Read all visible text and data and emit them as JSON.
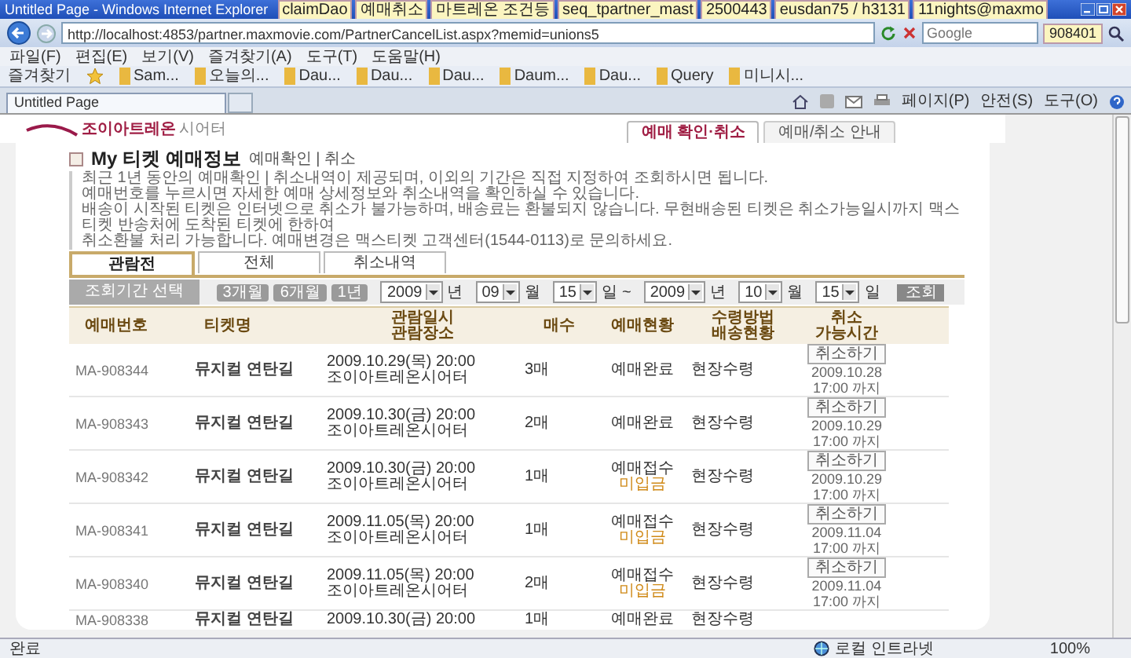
{
  "window": {
    "title": "Untitled Page - Windows Internet Explorer"
  },
  "overlay_notes": [
    "claimDao",
    "예매취소",
    "마트레온 조건등",
    "seq_tpartner_mast",
    "2500443",
    "eusdan75 / h3131",
    "11nights@maxmo"
  ],
  "address_bar": {
    "url": "http://localhost:4853/partner.maxmovie.com/PartnerCancelList.aspx?memid=unions5"
  },
  "search": {
    "placeholder": "Google",
    "note": "908401"
  },
  "menu": [
    "파일(F)",
    "편집(E)",
    "보기(V)",
    "즐겨찾기(A)",
    "도구(T)",
    "도움말(H)"
  ],
  "favorites": {
    "label": "즐겨찾기",
    "items": [
      "Sam...",
      "오늘의...",
      "Dau...",
      "Dau...",
      "Dau...",
      "Daum...",
      "Dau...",
      "Query",
      "미니시..."
    ]
  },
  "browser_tabs": [
    {
      "label": "Untitled Page",
      "selected": true
    }
  ],
  "command_bar": [
    "페이지(P)",
    "안전(S)",
    "도구(O)"
  ],
  "site": {
    "logo": {
      "main": "조이아트레온",
      "sub": "시어터"
    },
    "nav_tabs": [
      {
        "label": "예매 확인·취소",
        "selected": true
      },
      {
        "label": "예매/취소 안내",
        "selected": false
      }
    ],
    "heading": {
      "title": "My 티켓 예매정보",
      "subtitle": "예매확인 | 취소"
    },
    "notice": [
      "최근 1년 동안의 예매확인 | 취소내역이 제공되며, 이외의 기간은 직접 지정하여 조회하시면 됩니다.",
      "예매번호를 누르시면 자세한 예매 상세정보와 취소내역을 확인하실 수 있습니다.",
      "배송이 시작된 티켓은 인터넷으로 취소가 불가능하며, 배송료는 환불되지 않습니다. 무현배송된 티켓은 취소가능일시까지 맥스티켓 반송처에 도착된 티켓에 한하여",
      "취소환불 처리 가능합니다. 예매변경은 맥스티켓 고객센터(1544-0113)로 문의하세요."
    ],
    "tabs": [
      {
        "label": "관람전",
        "selected": true
      },
      {
        "label": "전체",
        "selected": false
      },
      {
        "label": "취소내역",
        "selected": false
      }
    ],
    "filter": {
      "label": "조회기간 선택",
      "presets": [
        "3개월",
        "6개월",
        "1년"
      ],
      "from": [
        {
          "value": "2009",
          "unit": "년"
        },
        {
          "value": "09",
          "unit": "월"
        },
        {
          "value": "15",
          "unit": "일"
        }
      ],
      "separator": "~",
      "to": [
        {
          "value": "2009",
          "unit": "년"
        },
        {
          "value": "10",
          "unit": "월"
        },
        {
          "value": "15",
          "unit": "일"
        }
      ],
      "search_button": "조회"
    },
    "table": {
      "columns": [
        [
          "예매번호"
        ],
        [
          "티켓명"
        ],
        [
          "관람일시",
          "관람장소"
        ],
        [
          "매수"
        ],
        [
          "예매현황"
        ],
        [
          "수령방법",
          "배송현황"
        ],
        [
          "취소",
          "가능시간"
        ]
      ],
      "rows": [
        {
          "booking_no": "MA-908344",
          "title": "뮤지컬 연탄길",
          "datetime": "2009.10.29(목) 20:00",
          "venue": "조이아트레온시어터",
          "quantity": "3매",
          "status": "예매완료",
          "pickup": "현장수령",
          "cancel_button": "취소하기",
          "cancel_deadline": [
            "2009.10.28",
            "17:00 까지"
          ]
        },
        {
          "booking_no": "MA-908343",
          "title": "뮤지컬 연탄길",
          "datetime": "2009.10.30(금) 20:00",
          "venue": "조이아트레온시어터",
          "quantity": "2매",
          "status": "예매완료",
          "pickup": "현장수령",
          "cancel_button": "취소하기",
          "cancel_deadline": [
            "2009.10.29",
            "17:00 까지"
          ]
        },
        {
          "booking_no": "MA-908342",
          "title": "뮤지컬 연탄길",
          "datetime": "2009.10.30(금) 20:00",
          "venue": "조이아트레온시어터",
          "quantity": "1매",
          "status": "예매접수",
          "payment": "미입금",
          "pickup": "현장수령",
          "cancel_button": "취소하기",
          "cancel_deadline": [
            "2009.10.29",
            "17:00 까지"
          ]
        },
        {
          "booking_no": "MA-908341",
          "title": "뮤지컬 연탄길",
          "datetime": "2009.11.05(목) 20:00",
          "venue": "조이아트레온시어터",
          "quantity": "1매",
          "status": "예매접수",
          "payment": "미입금",
          "pickup": "현장수령",
          "cancel_button": "취소하기",
          "cancel_deadline": [
            "2009.11.04",
            "17:00 까지"
          ]
        },
        {
          "booking_no": "MA-908340",
          "title": "뮤지컬 연탄길",
          "datetime": "2009.11.05(목) 20:00",
          "venue": "조이아트레온시어터",
          "quantity": "2매",
          "status": "예매접수",
          "payment": "미입금",
          "pickup": "현장수령",
          "cancel_button": "취소하기",
          "cancel_deadline": [
            "2009.11.04",
            "17:00 까지"
          ]
        },
        {
          "booking_no": "MA-908338",
          "title": "뮤지컬 연탄길",
          "datetime": "2009.10.30(금) 20:00",
          "quantity": "1매",
          "status": "예매완료",
          "pickup": "현장수령"
        }
      ]
    }
  },
  "status_bar": {
    "text": "완료",
    "zone": "로컬 인트라넷",
    "zoom": "100%"
  }
}
